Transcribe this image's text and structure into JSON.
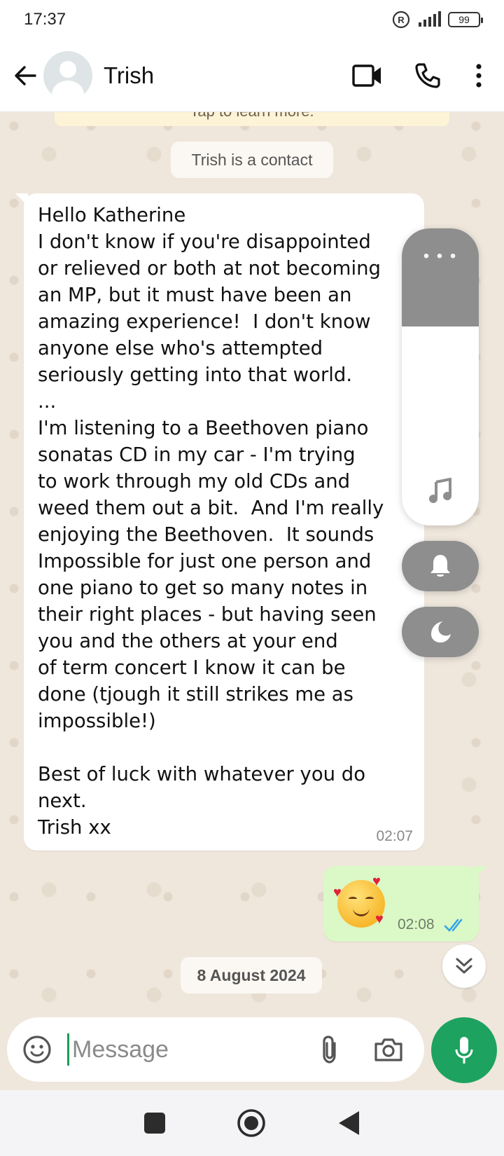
{
  "status_bar": {
    "time": "17:37",
    "battery": "99"
  },
  "header": {
    "contact_name": "Trish"
  },
  "chat": {
    "tip_text": "Tap to learn more.",
    "contact_notice": "Trish is a contact",
    "incoming_message": {
      "text": "Hello Katherine\nI don't know if you're disappointed\nor relieved or both at not becoming\nan MP, but it must have been an\namazing experience!  I don't know\nanyone else who's attempted\nseriously getting into that world.\n...\nI'm listening to a Beethoven piano\nsonatas CD in my car - I'm trying\nto work through my old CDs and\nweed them out a bit.  And I'm really\nenjoying the Beethoven.  It sounds\nImpossible for just one person and\none piano to get so many notes in\ntheir right places - but having seen\nyou and the others at your end\nof term concert I know it can be\ndone (tjough it still strikes me as\nimpossible!)\n\nBest of luck with whatever you do\nnext.\nTrish xx",
      "time": "02:07"
    },
    "outgoing_message": {
      "emoji": "smiling-face-with-hearts",
      "time": "02:08",
      "status": "read"
    },
    "date_divider": "8 August 2024"
  },
  "volume_overlay": {
    "level": 0.33
  },
  "composer": {
    "placeholder": "Message"
  },
  "colors": {
    "accent": "#1da35f",
    "outgoing_bubble": "#dbf8c7",
    "read_ticks": "#34a4e8"
  }
}
